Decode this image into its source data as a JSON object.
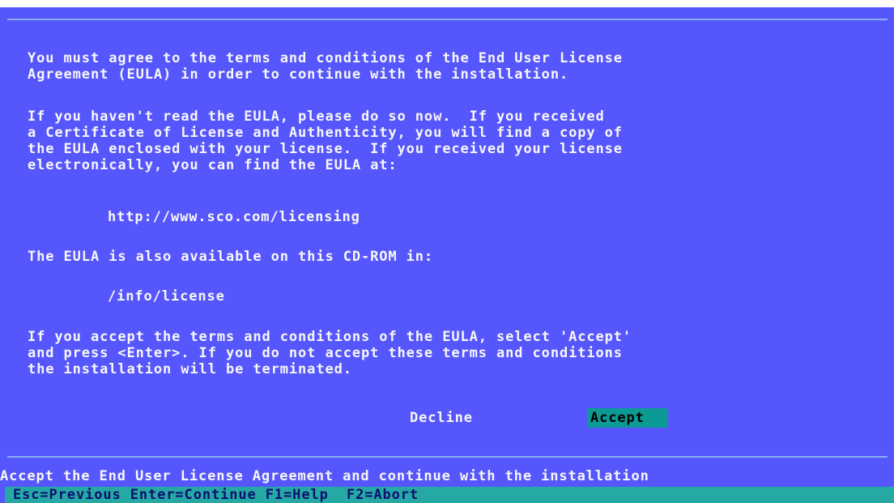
{
  "dialog": {
    "paragraph1": "You must agree to the terms and conditions of the End User License\nAgreement (EULA) in order to continue with the installation.",
    "paragraph2": "If you haven't read the EULA, please do so now.  If you received\na Certificate of License and Authenticity, you will find a copy of\nthe EULA enclosed with your license.  If you received your license\nelectronically, you can find the EULA at:",
    "url": "http://www.sco.com/licensing",
    "paragraph3": "The EULA is also available on this CD-ROM in:",
    "path": "/info/license",
    "paragraph4": "If you accept the terms and conditions of the EULA, select 'Accept'\nand press <Enter>. If you do not accept these terms and conditions\nthe installation will be terminated.",
    "buttons": {
      "decline": "Decline",
      "accept": "Accept"
    }
  },
  "status": {
    "description": "Accept the End User License Agreement and continue with the installation",
    "hints": "Esc=Previous Enter=Continue F1=Help  F2=Abort"
  },
  "colors": {
    "background": "#5656fd",
    "text": "#f7f7f7",
    "selected_button": "#0c9a95",
    "hint_bar": "#26a9a4",
    "hint_text": "#0b1070",
    "frame_line": "#8ab0f4"
  }
}
